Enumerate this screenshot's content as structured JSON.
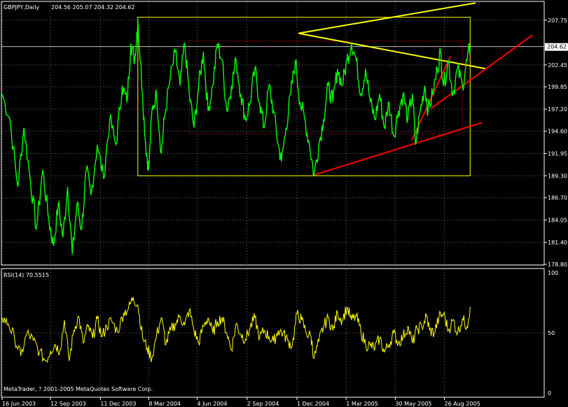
{
  "colors": {
    "background": "#000000",
    "frame": "#ffffff",
    "grid": "#5f6b6b",
    "price": "#00ff00",
    "rsi": "#ffff00",
    "box": "#ffff00",
    "yellow_line": "#ffff00",
    "red_line": "#ff0000",
    "dotted": "#ff0000",
    "current_price_line": "#c0c0c0",
    "text": "#ffffff"
  },
  "chart_data": [
    {
      "type": "line",
      "title": "GBPJPY,Daily",
      "ohlc": "204.56 205.07 204.32 204.62",
      "current_price_label": "204.62",
      "current_price": 204.62,
      "ylim": [
        178.8,
        209.9
      ],
      "grid": true,
      "yticks": [
        "207.75",
        "204.62",
        "202.45",
        "199.85",
        "197.20",
        "194.60",
        "191.95",
        "189.30",
        "186.70",
        "184.05",
        "181.40",
        "178.80"
      ],
      "ytick_values": [
        207.75,
        204.62,
        202.45,
        199.85,
        197.2,
        194.6,
        191.95,
        189.3,
        186.7,
        184.05,
        181.4,
        178.8
      ],
      "xticks": [
        "16 Jun 2003",
        "12 Sep 2003",
        "11 Dec 2003",
        "8 Mar 2004",
        "4 Jun 2004",
        "2 Sep 2004",
        "1 Dec 2004",
        "1 Mar 2005",
        "30 May 2005",
        "26 Aug 2005"
      ],
      "xtick_index": [
        0,
        62,
        126,
        188,
        250,
        314,
        378,
        441,
        504,
        567
      ],
      "series": [
        {
          "values": [
            [
              0,
              199
            ],
            [
              10,
              196
            ],
            [
              20,
              188
            ],
            [
              28,
              195
            ],
            [
              36,
              189
            ],
            [
              44,
              183
            ],
            [
              52,
              190
            ],
            [
              60,
              184
            ],
            [
              66,
              181
            ],
            [
              72,
              186
            ],
            [
              78,
              182
            ],
            [
              84,
              188
            ],
            [
              90,
              180
            ],
            [
              96,
              186
            ],
            [
              102,
              183
            ],
            [
              108,
              190
            ],
            [
              114,
              187
            ],
            [
              122,
              193
            ],
            [
              130,
              189
            ],
            [
              138,
              196
            ],
            [
              146,
              193
            ],
            [
              154,
              200
            ],
            [
              160,
              198
            ],
            [
              165,
              205
            ],
            [
              170,
              203
            ],
            [
              174,
              207.8
            ],
            [
              180,
              199
            ],
            [
              184,
              193
            ],
            [
              188,
              190
            ],
            [
              192,
              197
            ],
            [
              198,
              199
            ],
            [
              204,
              192
            ],
            [
              208,
              196
            ],
            [
              214,
              200
            ],
            [
              222,
              204
            ],
            [
              228,
              200
            ],
            [
              234,
              205
            ],
            [
              240,
              199
            ],
            [
              246,
              195
            ],
            [
              252,
              200
            ],
            [
              258,
              204
            ],
            [
              264,
              197
            ],
            [
              270,
              200
            ],
            [
              276,
              205
            ],
            [
              282,
              203
            ],
            [
              288,
              197
            ],
            [
              294,
              200
            ],
            [
              300,
              203
            ],
            [
              306,
              199
            ],
            [
              312,
              196
            ],
            [
              318,
              198
            ],
            [
              324,
              202
            ],
            [
              330,
              198
            ],
            [
              336,
              195
            ],
            [
              342,
              200
            ],
            [
              348,
              197
            ],
            [
              354,
              193
            ],
            [
              358,
              191
            ],
            [
              364,
              195
            ],
            [
              370,
              199
            ],
            [
              376,
              203
            ],
            [
              382,
              198
            ],
            [
              388,
              196
            ],
            [
              394,
              193
            ],
            [
              400,
              189.4
            ],
            [
              406,
              193
            ],
            [
              412,
              196
            ],
            [
              418,
              200
            ],
            [
              424,
              198
            ],
            [
              430,
              202
            ],
            [
              436,
              200
            ],
            [
              442,
              203
            ],
            [
              448,
              205
            ],
            [
              454,
              203
            ],
            [
              460,
              199
            ],
            [
              466,
              202
            ],
            [
              472,
              198
            ],
            [
              478,
              196
            ],
            [
              484,
              199
            ],
            [
              490,
              195
            ],
            [
              496,
              198
            ],
            [
              502,
              194
            ],
            [
              508,
              197
            ],
            [
              514,
              199
            ],
            [
              520,
              196
            ],
            [
              526,
              199
            ],
            [
              530,
              193
            ],
            [
              536,
              197
            ],
            [
              542,
              200
            ],
            [
              546,
              197
            ],
            [
              552,
              199
            ],
            [
              558,
              202
            ],
            [
              562,
              204
            ],
            [
              566,
              200
            ],
            [
              572,
              203
            ],
            [
              578,
              199
            ],
            [
              584,
              202
            ],
            [
              590,
              200
            ],
            [
              596,
              203
            ],
            [
              600,
              204.62
            ]
          ]
        }
      ],
      "annotations": {
        "box": {
          "x": [
            174,
            600
          ],
          "y": [
            189.3,
            208.1
          ]
        },
        "dotted_box": {
          "x": [
            240,
            590
          ],
          "y": [
            194.3,
            205.3
          ]
        },
        "yellow_lines": [
          {
            "from": [
              380,
              206.2
            ],
            "to": [
              607,
              209.8
            ]
          },
          {
            "from": [
              380,
              206.2
            ],
            "to": [
              620,
              202.0
            ]
          }
        ],
        "red_lines": [
          {
            "from": [
              400,
              189.4
            ],
            "to": [
              615,
              195.6
            ]
          },
          {
            "from": [
              525,
              193.5
            ],
            "to": [
              575,
              203.5
            ]
          },
          {
            "from": [
              550,
              197.3
            ],
            "to": [
              680,
              206.0
            ]
          }
        ]
      }
    },
    {
      "type": "line",
      "title": "RSI(14) 70.5515",
      "ylim": [
        0,
        100
      ],
      "yticks": [
        "100",
        "50",
        "0"
      ],
      "ytick_values": [
        100,
        50,
        0
      ],
      "series": [
        {
          "values": [
            [
              0,
              62
            ],
            [
              8,
              57
            ],
            [
              16,
              46
            ],
            [
              24,
              32
            ],
            [
              32,
              50
            ],
            [
              40,
              44
            ],
            [
              48,
              35
            ],
            [
              56,
              28
            ],
            [
              62,
              36
            ],
            [
              68,
              41
            ],
            [
              74,
              36
            ],
            [
              80,
              60
            ],
            [
              86,
              28
            ],
            [
              92,
              52
            ],
            [
              98,
              63
            ],
            [
              104,
              42
            ],
            [
              110,
              55
            ],
            [
              116,
              46
            ],
            [
              122,
              61
            ],
            [
              128,
              47
            ],
            [
              134,
              55
            ],
            [
              140,
              60
            ],
            [
              148,
              51
            ],
            [
              156,
              66
            ],
            [
              162,
              69
            ],
            [
              168,
              78
            ],
            [
              174,
              72
            ],
            [
              180,
              47
            ],
            [
              186,
              38
            ],
            [
              192,
              30
            ],
            [
              198,
              48
            ],
            [
              204,
              62
            ],
            [
              210,
              41
            ],
            [
              216,
              52
            ],
            [
              222,
              57
            ],
            [
              228,
              63
            ],
            [
              234,
              56
            ],
            [
              240,
              68
            ],
            [
              246,
              52
            ],
            [
              252,
              42
            ],
            [
              258,
              55
            ],
            [
              264,
              62
            ],
            [
              270,
              50
            ],
            [
              276,
              59
            ],
            [
              282,
              62
            ],
            [
              288,
              50
            ],
            [
              294,
              37
            ],
            [
              300,
              57
            ],
            [
              306,
              49
            ],
            [
              312,
              45
            ],
            [
              318,
              54
            ],
            [
              324,
              62
            ],
            [
              330,
              46
            ],
            [
              336,
              52
            ],
            [
              342,
              47
            ],
            [
              348,
              43
            ],
            [
              354,
              52
            ],
            [
              360,
              50
            ],
            [
              366,
              44
            ],
            [
              372,
              40
            ],
            [
              378,
              65
            ],
            [
              384,
              60
            ],
            [
              390,
              50
            ],
            [
              396,
              47
            ],
            [
              400,
              30
            ],
            [
              406,
              43
            ],
            [
              412,
              55
            ],
            [
              418,
              62
            ],
            [
              424,
              52
            ],
            [
              430,
              66
            ],
            [
              436,
              60
            ],
            [
              442,
              70
            ],
            [
              448,
              60
            ],
            [
              454,
              63
            ],
            [
              460,
              51
            ],
            [
              466,
              41
            ],
            [
              472,
              40
            ],
            [
              478,
              38
            ],
            [
              484,
              46
            ],
            [
              490,
              35
            ],
            [
              496,
              41
            ],
            [
              502,
              50
            ],
            [
              508,
              42
            ],
            [
              514,
              47
            ],
            [
              520,
              55
            ],
            [
              526,
              42
            ],
            [
              532,
              53
            ],
            [
              538,
              55
            ],
            [
              544,
              63
            ],
            [
              548,
              52
            ],
            [
              554,
              50
            ],
            [
              560,
              62
            ],
            [
              566,
              65
            ],
            [
              572,
              52
            ],
            [
              578,
              60
            ],
            [
              584,
              50
            ],
            [
              590,
              61
            ],
            [
              596,
              55
            ],
            [
              600,
              70.55
            ]
          ]
        }
      ]
    }
  ],
  "footer": {
    "copyright": "MetaTrader, ? 2001-2005 MetaQuotes Software Corp."
  }
}
